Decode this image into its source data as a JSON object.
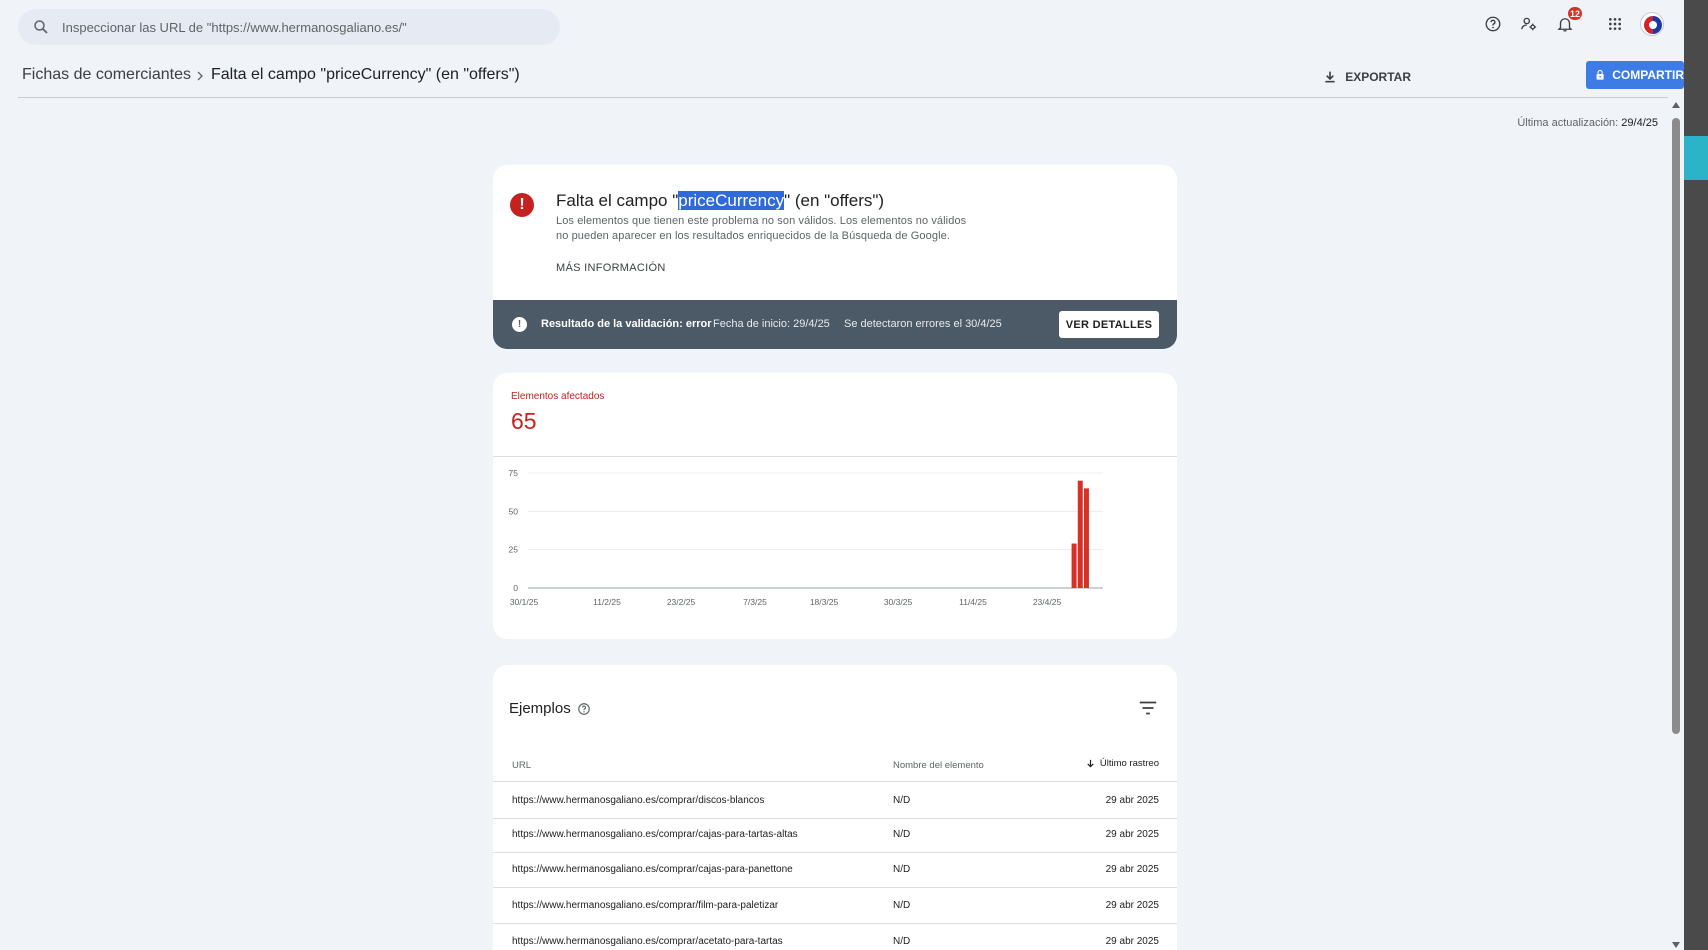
{
  "search": {
    "placeholder": "Inspeccionar las URL de \"https://www.hermanosgaliano.es/\""
  },
  "topbar": {
    "notifications_count": "12"
  },
  "breadcrumb": {
    "parent": "Fichas de comerciantes",
    "current": "Falta el campo \"priceCurrency\" (en \"offers\")"
  },
  "actions": {
    "export_label": "EXPORTAR",
    "share_label": "COMPARTIR"
  },
  "last_update": {
    "label": "Última actualización:",
    "value": "29/4/25"
  },
  "issue": {
    "title_before": "Falta el campo \"",
    "title_highlight": "priceCurrency",
    "title_after": "\" (en \"offers\")",
    "description": "Los elementos que tienen este problema no son válidos. Los elementos no válidos no pueden aparecer en los resultados enriquecidos de la Búsqueda de Google.",
    "more_info": "MÁS INFORMACIÓN"
  },
  "validation": {
    "result": "Resultado de la validación: error",
    "start_date": "Fecha de inicio: 29/4/25",
    "detected": "Se detectaron errores el 30/4/25",
    "details_button": "VER DETALLES"
  },
  "affected": {
    "label": "Elementos afectados",
    "value": "65"
  },
  "chart_data": {
    "type": "bar",
    "ylim": [
      0,
      75
    ],
    "yticks": [
      "0",
      "25",
      "50",
      "75"
    ],
    "xtick_labels": [
      "30/1/25",
      "11/2/25",
      "23/2/25",
      "7/3/25",
      "18/3/25",
      "30/3/25",
      "11/4/25",
      "23/4/25"
    ],
    "total_days": 91,
    "bars": [
      {
        "day": 88,
        "value": 29
      },
      {
        "day": 89,
        "value": 70
      },
      {
        "day": 90,
        "value": 65
      }
    ],
    "color": "#d93025"
  },
  "examples": {
    "title": "Ejemplos",
    "columns": {
      "url": "URL",
      "name": "Nombre del elemento",
      "date": "Último rastreo"
    },
    "rows": [
      {
        "url": "https://www.hermanosgaliano.es/comprar/discos-blancos",
        "name": "N/D",
        "date": "29 abr 2025"
      },
      {
        "url": "https://www.hermanosgaliano.es/comprar/cajas-para-tartas-altas",
        "name": "N/D",
        "date": "29 abr 2025"
      },
      {
        "url": "https://www.hermanosgaliano.es/comprar/cajas-para-panettone",
        "name": "N/D",
        "date": "29 abr 2025"
      },
      {
        "url": "https://www.hermanosgaliano.es/comprar/film-para-paletizar",
        "name": "N/D",
        "date": "29 abr 2025"
      },
      {
        "url": "https://www.hermanosgaliano.es/comprar/acetato-para-tartas",
        "name": "N/D",
        "date": "29 abr 2025"
      }
    ]
  }
}
